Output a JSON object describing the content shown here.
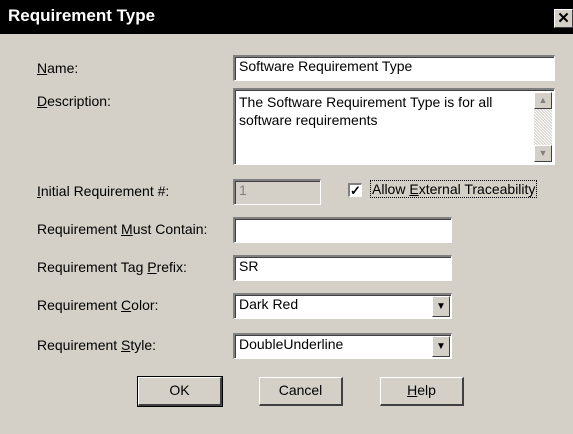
{
  "window": {
    "title": "Requirement Type",
    "close_glyph": "✕"
  },
  "form": {
    "name": {
      "label_pre": "",
      "label_key": "N",
      "label_post": "ame:",
      "value": "Software Requirement Type"
    },
    "description": {
      "label_pre": "",
      "label_key": "D",
      "label_post": "escription:",
      "value": "The Software Requirement Type is for all software requirements"
    },
    "initial_req": {
      "label_pre": "",
      "label_key": "I",
      "label_post": "nitial Requirement #:",
      "value": "1"
    },
    "external_trace": {
      "label_pre": "Allow ",
      "label_key": "E",
      "label_post": "xternal Traceability",
      "checked": true,
      "check_glyph": "✓"
    },
    "must_contain": {
      "label_pre": "Requirement ",
      "label_key": "M",
      "label_post": "ust Contain:",
      "value": ""
    },
    "tag_prefix": {
      "label_pre": "Requirement Tag ",
      "label_key": "P",
      "label_post": "refix:",
      "value": "SR"
    },
    "color": {
      "label_pre": "Requirement ",
      "label_key": "C",
      "label_post": "olor:",
      "value": "Dark Red"
    },
    "style": {
      "label_pre": "Requirement ",
      "label_key": "S",
      "label_post": "tyle:",
      "value": "DoubleUnderline"
    }
  },
  "buttons": {
    "ok": "OK",
    "cancel": "Cancel",
    "help": {
      "pre": "",
      "key": "H",
      "post": "elp"
    }
  },
  "icons": {
    "dropdown": "▼",
    "scroll_up": "▲",
    "scroll_down": "▼"
  }
}
